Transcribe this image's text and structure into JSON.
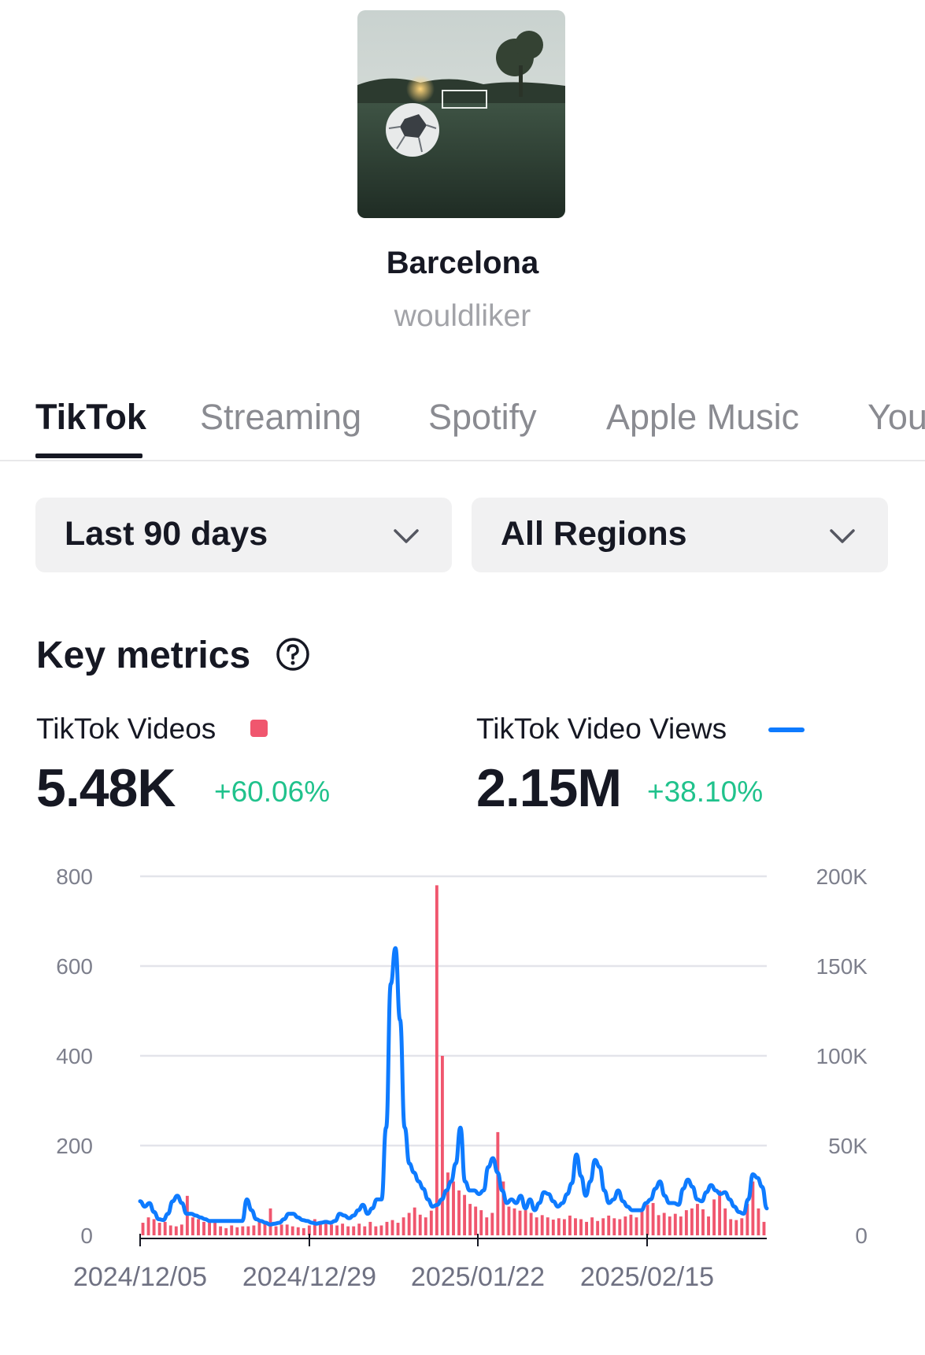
{
  "track": {
    "title": "Barcelona",
    "artist": "wouldliker"
  },
  "tabs": [
    {
      "label": "TikTok",
      "active": true
    },
    {
      "label": "Streaming",
      "active": false
    },
    {
      "label": "Spotify",
      "active": false
    },
    {
      "label": "Apple Music",
      "active": false
    },
    {
      "label": "You",
      "active": false
    }
  ],
  "filters": {
    "period": "Last 90 days",
    "region": "All Regions"
  },
  "key_metrics": {
    "title": "Key metrics",
    "videos": {
      "label": "TikTok Videos",
      "value": "5.48K",
      "change": "+60.06%"
    },
    "views": {
      "label": "TikTok Video Views",
      "value": "2.15M",
      "change": "+38.10%"
    }
  },
  "colors": {
    "videos": "#f0566e",
    "views": "#0e7bff",
    "positive": "#20c28c",
    "grid": "#e3e4ea"
  },
  "icons": {
    "help": "question-circle-icon",
    "dropdown": "chevron-down-icon"
  },
  "chart_data": {
    "type": "bar+line",
    "x_ticks": [
      "2024/12/05",
      "2024/12/29",
      "2025/01/22",
      "2025/02/15"
    ],
    "y_left": {
      "ticks": [
        "0",
        "200",
        "400",
        "600",
        "800"
      ],
      "range": [
        0,
        800
      ]
    },
    "y_right": {
      "ticks": [
        "0",
        "50K",
        "100K",
        "150K",
        "200K"
      ],
      "range": [
        0,
        200000
      ]
    },
    "series": [
      {
        "name": "TikTok Videos",
        "type": "bar",
        "axis": "left",
        "values": [
          28,
          40,
          36,
          28,
          30,
          22,
          20,
          24,
          88,
          40,
          36,
          30,
          28,
          30,
          20,
          16,
          22,
          18,
          20,
          20,
          22,
          30,
          32,
          60,
          20,
          24,
          24,
          20,
          18,
          16,
          22,
          36,
          30,
          28,
          24,
          22,
          26,
          20,
          20,
          26,
          20,
          30,
          20,
          22,
          30,
          34,
          28,
          40,
          50,
          62,
          46,
          40,
          55,
          780,
          400,
          140,
          120,
          100,
          90,
          70,
          64,
          56,
          40,
          50,
          230,
          120,
          64,
          60,
          55,
          56,
          50,
          40,
          45,
          40,
          35,
          38,
          36,
          44,
          38,
          36,
          30,
          40,
          32,
          38,
          44,
          38,
          36,
          42,
          46,
          40,
          60,
          68,
          72,
          45,
          50,
          42,
          48,
          42,
          56,
          60,
          70,
          58,
          42,
          80,
          100,
          60,
          36,
          34,
          38,
          70,
          120,
          60,
          30
        ],
        "note": "approximate daily values"
      },
      {
        "name": "TikTok Video Views",
        "type": "line",
        "axis": "right",
        "values": [
          19000,
          16000,
          18000,
          13000,
          9000,
          8500,
          12000,
          19000,
          22000,
          18000,
          12000,
          12000,
          11000,
          10000,
          9000,
          8000,
          8000,
          8000,
          8000,
          8000,
          8000,
          8000,
          8000,
          20000,
          14000,
          9000,
          8000,
          7000,
          6000,
          6500,
          7000,
          9000,
          12000,
          12000,
          10000,
          8500,
          8000,
          7000,
          6500,
          7000,
          7500,
          7000,
          8000,
          12000,
          11000,
          9500,
          11000,
          14000,
          17000,
          12000,
          15000,
          20000,
          20000,
          60000,
          140000,
          160000,
          120000,
          60000,
          40000,
          35000,
          30000,
          26000,
          20000,
          16000,
          17000,
          20000,
          25000,
          30000,
          40000,
          60000,
          30000,
          25000,
          25000,
          23000,
          25000,
          38000,
          43000,
          35000,
          25000,
          18000,
          20000,
          18000,
          22000,
          15000,
          20000,
          14000,
          18000,
          24000,
          23000,
          19000,
          16000,
          18000,
          23000,
          29000,
          45000,
          33000,
          22000,
          30000,
          42000,
          38000,
          25000,
          18000,
          20000,
          25000,
          19000,
          16000,
          14000,
          14000,
          14000,
          18000,
          20000,
          26000,
          30000,
          22000,
          18000,
          18000,
          17000,
          26000,
          31000,
          27000,
          20000,
          19000,
          24000,
          28000,
          25000,
          23000,
          24000,
          20000,
          16000,
          13000,
          12000,
          20000,
          34000,
          32000,
          27000,
          15000
        ],
        "note": "approximate daily values"
      }
    ]
  }
}
